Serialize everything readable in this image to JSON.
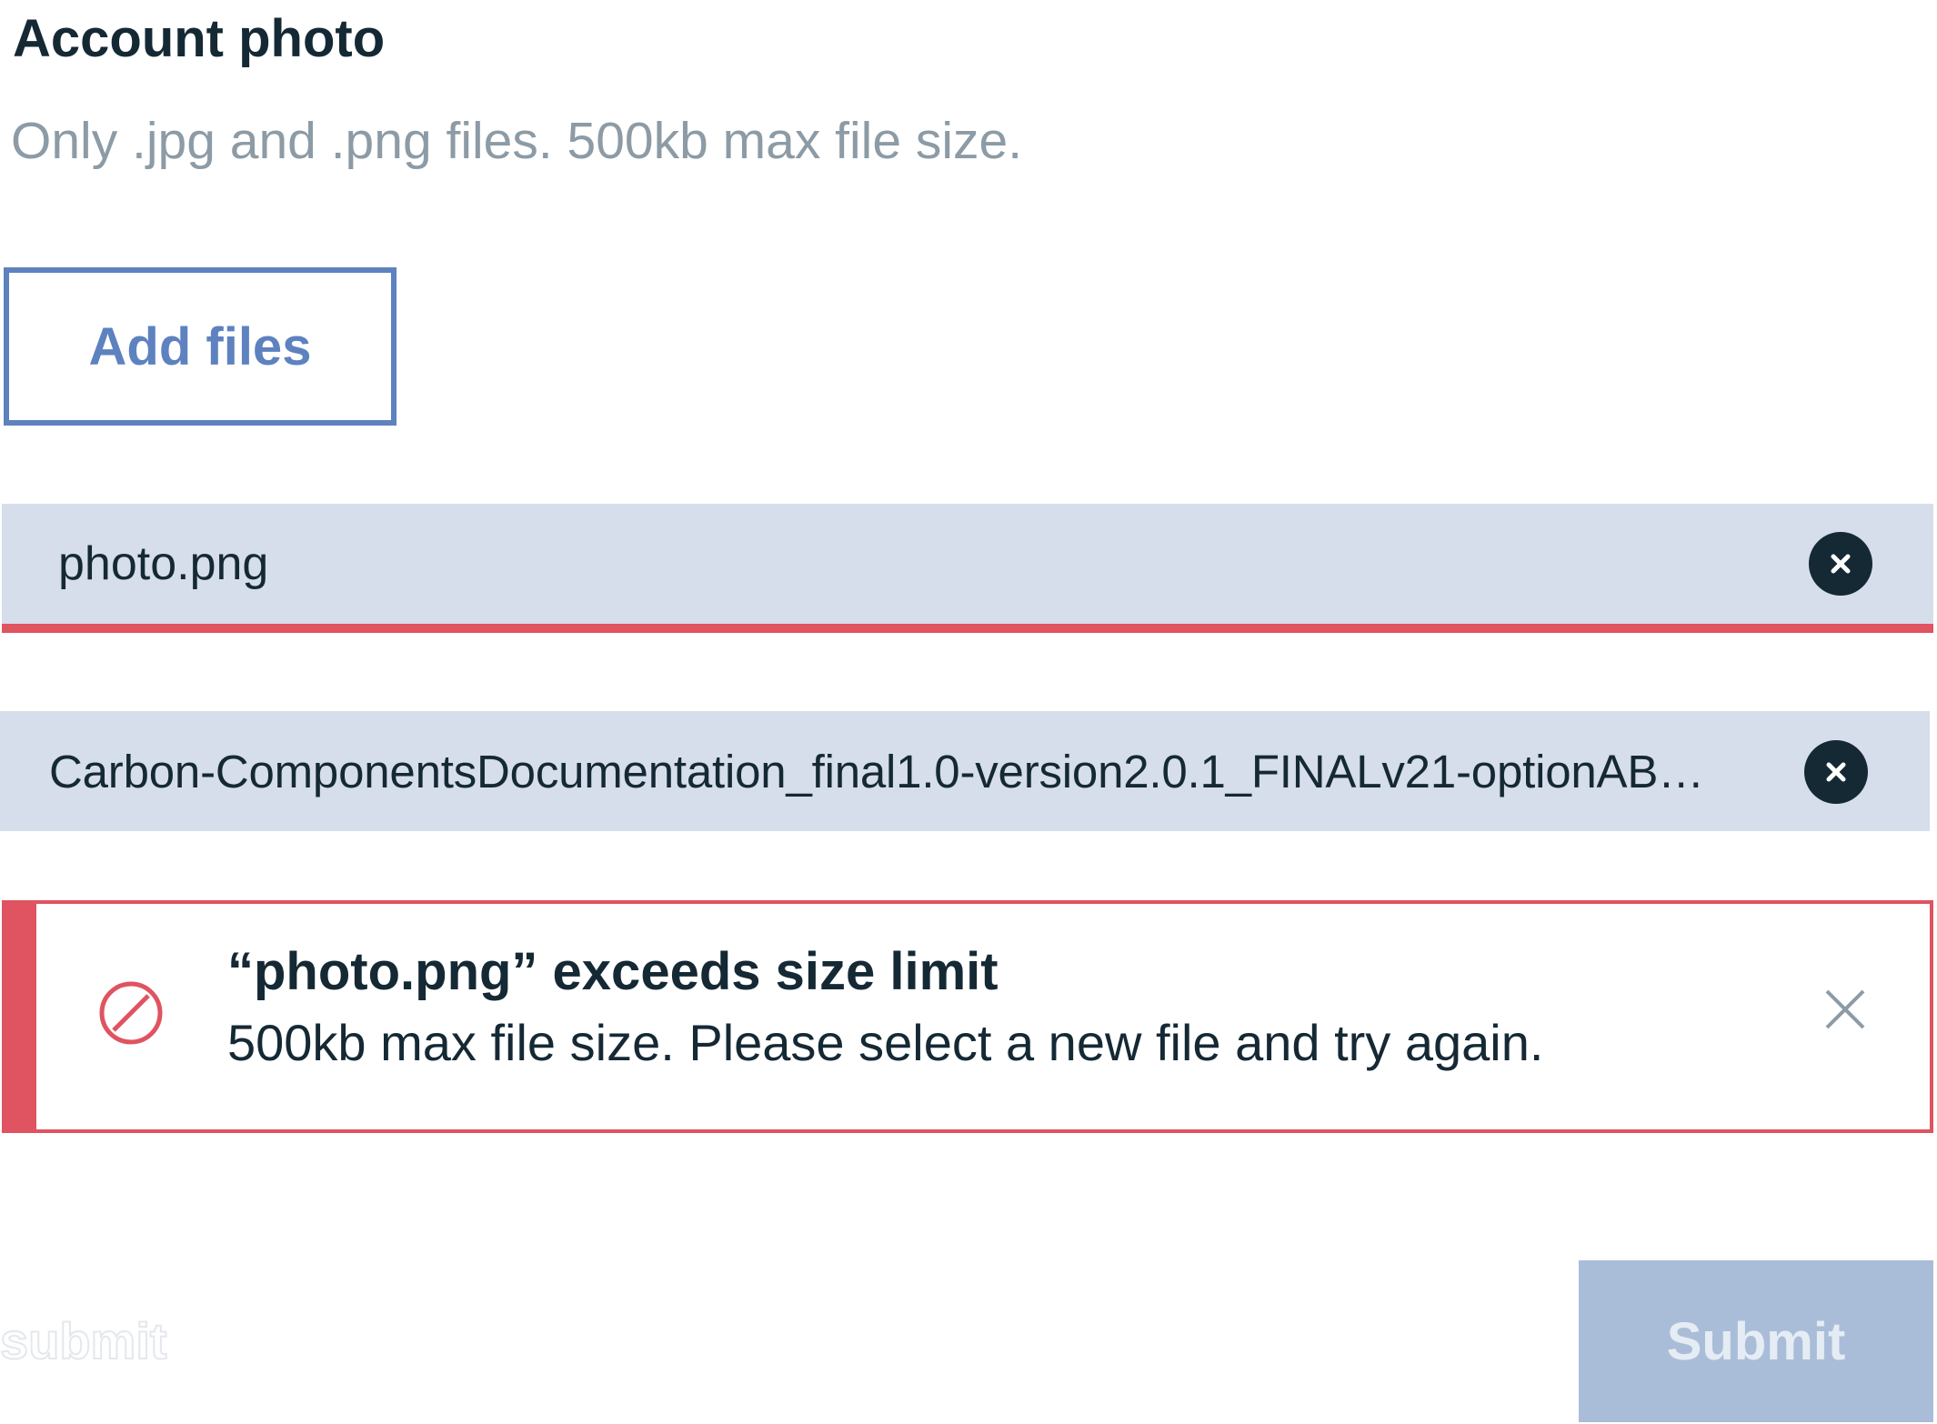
{
  "form": {
    "heading": "Account photo",
    "description": "Only .jpg and .png files. 500kb max file size.",
    "add_files_label": "Add files"
  },
  "files": [
    {
      "name": "photo.png",
      "status": "error"
    },
    {
      "name": "Carbon-ComponentsDocumentation_final1.0-version2.0.1_FINALv21-optionAB…",
      "status": "complete"
    }
  ],
  "notification": {
    "kind": "error",
    "title": "“photo.png” exceeds size limit",
    "subtitle": "500kb max file size. Please select a new file and try again."
  },
  "footer": {
    "ghost_label": "submit",
    "submit_label": "Submit",
    "submit_disabled": "true"
  },
  "colors": {
    "brand": "#5d82bf",
    "error": "#e05360",
    "text": "#152935",
    "muted": "#8c9ba5",
    "file_row_bg": "#d5deea",
    "disabled_button": "#aabdd8"
  },
  "icons": {
    "remove": "close-circle-icon",
    "error": "prohibited-icon",
    "close": "close-icon"
  }
}
